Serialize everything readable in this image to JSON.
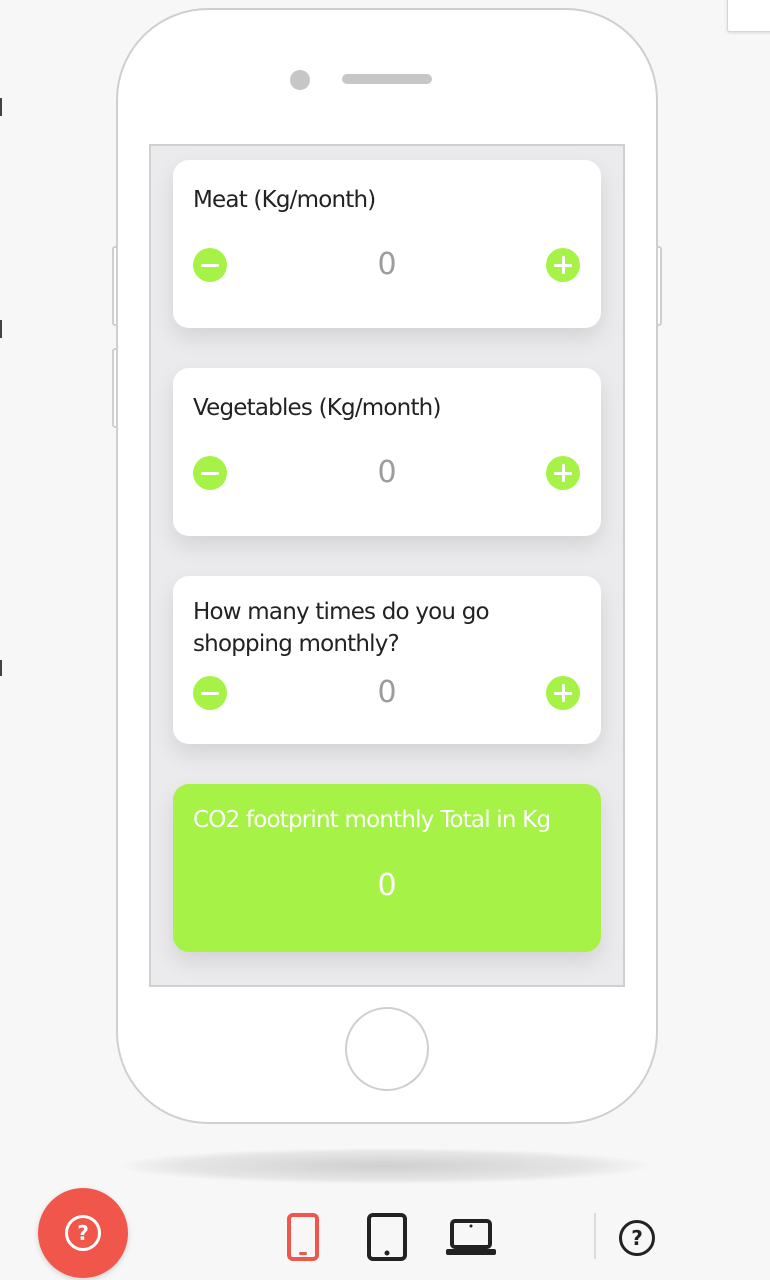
{
  "items": [
    {
      "label": "Meat (Kg/month)",
      "value": "0"
    },
    {
      "label": "Vegetables (Kg/month)",
      "value": "0"
    },
    {
      "label": "How many times do you go shopping monthly?",
      "value": "0"
    }
  ],
  "total": {
    "label": "CO2 footprint monthly Total in Kg",
    "value": "0"
  },
  "toolbar": {
    "help_fab_glyph": "?",
    "help_glyph": "?",
    "devices": [
      "phone-icon",
      "tablet-icon",
      "laptop-icon"
    ],
    "active_device": "phone-icon"
  },
  "colors": {
    "accent_green": "#a6f246",
    "fab_red": "#f1564a",
    "active_icon": "#f1564a",
    "icon_dark": "#222222"
  }
}
